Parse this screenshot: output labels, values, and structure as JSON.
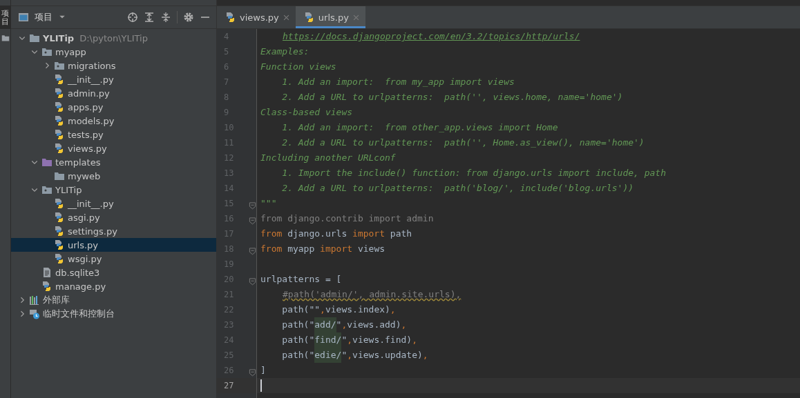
{
  "side_strip": {
    "tab_label": "项目"
  },
  "project_panel": {
    "title": "项目",
    "tree": [
      {
        "name": "YLITip",
        "path": "D:\\pyton\\YLITip",
        "kind": "folder",
        "expanded": true,
        "selected": false,
        "children": [
          {
            "name": "myapp",
            "kind": "module",
            "expanded": true,
            "selected": false,
            "children": [
              {
                "name": "migrations",
                "kind": "module",
                "expanded": false,
                "selected": false
              },
              {
                "name": "__init__.py",
                "kind": "python",
                "selected": false
              },
              {
                "name": "admin.py",
                "kind": "python",
                "selected": false
              },
              {
                "name": "apps.py",
                "kind": "python",
                "selected": false
              },
              {
                "name": "models.py",
                "kind": "python",
                "selected": false
              },
              {
                "name": "tests.py",
                "kind": "python",
                "selected": false
              },
              {
                "name": "views.py",
                "kind": "python",
                "selected": false
              }
            ]
          },
          {
            "name": "templates",
            "kind": "templates",
            "expanded": true,
            "selected": false,
            "children": [
              {
                "name": "myweb",
                "kind": "folder",
                "selected": false
              }
            ]
          },
          {
            "name": "YLITip",
            "kind": "module",
            "expanded": true,
            "selected": false,
            "children": [
              {
                "name": "__init__.py",
                "kind": "python",
                "selected": false
              },
              {
                "name": "asgi.py",
                "kind": "python",
                "selected": false
              },
              {
                "name": "settings.py",
                "kind": "python",
                "selected": false
              },
              {
                "name": "urls.py",
                "kind": "python",
                "selected": true
              },
              {
                "name": "wsgi.py",
                "kind": "python",
                "selected": false
              }
            ]
          },
          {
            "name": "db.sqlite3",
            "kind": "text",
            "selected": false
          },
          {
            "name": "manage.py",
            "kind": "python",
            "selected": false
          }
        ]
      },
      {
        "name": "外部库",
        "kind": "library",
        "expanded": false,
        "selected": false
      },
      {
        "name": "临时文件和控制台",
        "kind": "scratch",
        "expanded": false,
        "selected": false
      }
    ]
  },
  "tabs": [
    {
      "label": "views.py",
      "selected": false
    },
    {
      "label": "urls.py",
      "selected": true
    }
  ],
  "editor": {
    "lines": [
      {
        "number": "4",
        "indented": true,
        "segments": [
          {
            "text": "https://docs.djangoproject.com/en/3.2/topics/http/urls/",
            "kind": "link"
          }
        ]
      },
      {
        "number": "5",
        "segments": [
          {
            "text": "Examples:",
            "kind": "doc"
          }
        ]
      },
      {
        "number": "6",
        "segments": [
          {
            "text": "Function views",
            "kind": "doc"
          }
        ]
      },
      {
        "number": "7",
        "segments": [
          {
            "text": "    1. Add an import:  from my_app import views",
            "kind": "doc"
          }
        ]
      },
      {
        "number": "8",
        "segments": [
          {
            "text": "    2. Add a URL to urlpatterns:  path('', views.home, name='home')",
            "kind": "doc"
          }
        ]
      },
      {
        "number": "9",
        "segments": [
          {
            "text": "Class-based views",
            "kind": "doc"
          }
        ]
      },
      {
        "number": "10",
        "segments": [
          {
            "text": "    1. Add an import:  from other_app.views import Home",
            "kind": "doc"
          }
        ]
      },
      {
        "number": "11",
        "segments": [
          {
            "text": "    2. Add a URL to urlpatterns:  path('', Home.as_view(), name='home')",
            "kind": "doc"
          }
        ]
      },
      {
        "number": "12",
        "segments": [
          {
            "text": "Including another URLconf",
            "kind": "doc"
          }
        ]
      },
      {
        "number": "13",
        "segments": [
          {
            "text": "    1. Import the include() function: from django.urls import include, path",
            "kind": "doc"
          }
        ]
      },
      {
        "number": "14",
        "segments": [
          {
            "text": "    2. Add a URL to urlpatterns:  path('blog/', include('blog.urls'))",
            "kind": "doc"
          }
        ]
      },
      {
        "number": "15",
        "fold": true,
        "segments": [
          {
            "text": "\"\"\"",
            "kind": "doc"
          }
        ]
      },
      {
        "number": "16",
        "fold": true,
        "segments": [
          {
            "text": "from django.contrib import admin",
            "kind": "unused"
          }
        ]
      },
      {
        "number": "17",
        "segments": [
          {
            "text": "from",
            "kind": "keyword"
          },
          {
            "text": " django.urls ",
            "kind": "plain"
          },
          {
            "text": "import",
            "kind": "keyword"
          },
          {
            "text": " path",
            "kind": "plain"
          }
        ]
      },
      {
        "number": "18",
        "fold": true,
        "segments": [
          {
            "text": "from",
            "kind": "keyword"
          },
          {
            "text": " myapp ",
            "kind": "plain"
          },
          {
            "text": "import",
            "kind": "keyword"
          },
          {
            "text": " views",
            "kind": "plain"
          }
        ]
      },
      {
        "number": "19"
      },
      {
        "number": "20",
        "fold": true,
        "segments": [
          {
            "text": "urlpatterns = [",
            "kind": "plain"
          }
        ]
      },
      {
        "number": "21",
        "indented": true,
        "segments": [
          {
            "text": "#path('admin/', admin.site.urls),",
            "kind": "comment"
          }
        ]
      },
      {
        "number": "22",
        "segments": [
          {
            "text": "    path(",
            "kind": "plain"
          },
          {
            "text": "\"\"",
            "kind": "plain"
          },
          {
            "text": ",",
            "kind": "comma"
          },
          {
            "text": "views.index)",
            "kind": "plain"
          },
          {
            "text": ",",
            "kind": "comma"
          }
        ]
      },
      {
        "number": "23",
        "segments": [
          {
            "text": "    path(\"",
            "kind": "plain"
          },
          {
            "text": "add/",
            "kind": "match"
          },
          {
            "text": "\"",
            "kind": "plain"
          },
          {
            "text": ",",
            "kind": "comma"
          },
          {
            "text": "views.add)",
            "kind": "plain"
          },
          {
            "text": ",",
            "kind": "comma"
          }
        ]
      },
      {
        "number": "24",
        "segments": [
          {
            "text": "    path(\"",
            "kind": "plain"
          },
          {
            "text": "find/",
            "kind": "match"
          },
          {
            "text": "\"",
            "kind": "plain"
          },
          {
            "text": ",",
            "kind": "comma"
          },
          {
            "text": "views.find)",
            "kind": "plain"
          },
          {
            "text": ",",
            "kind": "comma"
          }
        ]
      },
      {
        "number": "25",
        "segments": [
          {
            "text": "    path(\"",
            "kind": "plain"
          },
          {
            "text": "edie/",
            "kind": "match"
          },
          {
            "text": "\"",
            "kind": "plain"
          },
          {
            "text": ",",
            "kind": "comma"
          },
          {
            "text": "views.update)",
            "kind": "plain"
          },
          {
            "text": ",",
            "kind": "comma"
          }
        ]
      },
      {
        "number": "26",
        "fold": true,
        "segments": [
          {
            "text": "]",
            "kind": "plain"
          }
        ]
      },
      {
        "number": "27",
        "current": true
      }
    ]
  }
}
